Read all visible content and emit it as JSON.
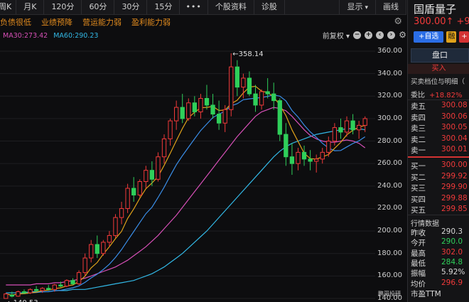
{
  "toolbar": {
    "tabs": [
      "周K",
      "月K",
      "120分",
      "60分",
      "30分",
      "15分",
      "•••",
      "个股资料",
      "诊股"
    ],
    "display_label": "显示",
    "draw_label": "画线"
  },
  "tags": [
    "负债很低",
    "业绩预降",
    "营运能力弱",
    "盈利能力弱"
  ],
  "ma": {
    "ma30": "MA30:273.42",
    "ma60": "MA60:290.23",
    "adjust_label": "前复权"
  },
  "colors": {
    "up": "#f23a3a",
    "down": "#2fcf5a",
    "ma5": "#e0a21a",
    "ma10": "#3a8ee8",
    "ma30": "#d64fb6",
    "ma60": "#32b8e6",
    "tag": "#e08a1e"
  },
  "chart_data": {
    "type": "candlestick",
    "y_ticks": [
      "360.00",
      "340.00",
      "320.00",
      "300.00",
      "280.00",
      "260.00",
      "240.00",
      "220.00",
      "200.00",
      "180.00",
      "160.00",
      "140.00"
    ],
    "ylim": [
      140,
      365
    ],
    "high_label": "358.14",
    "low_label": "140.53",
    "ohlc": [
      [
        140,
        145,
        140,
        144
      ],
      [
        143,
        146,
        141,
        142
      ],
      [
        142,
        147,
        141.5,
        146
      ],
      [
        146,
        148,
        144,
        145
      ],
      [
        145,
        149,
        144,
        148
      ],
      [
        148,
        151,
        146,
        147
      ],
      [
        147,
        150,
        145,
        149
      ],
      [
        149,
        152,
        147,
        148
      ],
      [
        148,
        153,
        146,
        152
      ],
      [
        152,
        155,
        150,
        151
      ],
      [
        151,
        157,
        150,
        156
      ],
      [
        156,
        158,
        152,
        153
      ],
      [
        153,
        165,
        152,
        163
      ],
      [
        163,
        180,
        160,
        176
      ],
      [
        176,
        192,
        172,
        188
      ],
      [
        188,
        196,
        176,
        180
      ],
      [
        180,
        192,
        178,
        190
      ],
      [
        190,
        200,
        186,
        196
      ],
      [
        196,
        215,
        194,
        212
      ],
      [
        212,
        226,
        206,
        220
      ],
      [
        220,
        242,
        216,
        238
      ],
      [
        238,
        248,
        226,
        232
      ],
      [
        232,
        246,
        230,
        244
      ],
      [
        244,
        258,
        238,
        254
      ],
      [
        254,
        262,
        240,
        246
      ],
      [
        246,
        270,
        244,
        266
      ],
      [
        266,
        286,
        260,
        282
      ],
      [
        282,
        300,
        276,
        298
      ],
      [
        298,
        316,
        290,
        310
      ],
      [
        310,
        322,
        296,
        300
      ],
      [
        300,
        318,
        298,
        314
      ],
      [
        314,
        320,
        302,
        306
      ],
      [
        306,
        322,
        300,
        318
      ],
      [
        318,
        330,
        308,
        312
      ],
      [
        312,
        322,
        300,
        304
      ],
      [
        304,
        316,
        290,
        296
      ],
      [
        296,
        312,
        288,
        308
      ],
      [
        308,
        358.14,
        302,
        346
      ],
      [
        346,
        352,
        320,
        328
      ],
      [
        328,
        340,
        318,
        336
      ],
      [
        336,
        342,
        320,
        322
      ],
      [
        322,
        330,
        306,
        312
      ],
      [
        312,
        326,
        308,
        324
      ],
      [
        324,
        336,
        318,
        322
      ],
      [
        322,
        332,
        308,
        316
      ],
      [
        316,
        318,
        280,
        286
      ],
      [
        286,
        296,
        258,
        266
      ],
      [
        266,
        278,
        250,
        260
      ],
      [
        260,
        274,
        254,
        270
      ],
      [
        270,
        276,
        258,
        264
      ],
      [
        264,
        272,
        254,
        262
      ],
      [
        262,
        268,
        252,
        264
      ],
      [
        264,
        274,
        260,
        270
      ],
      [
        270,
        284,
        266,
        280
      ],
      [
        280,
        296,
        276,
        292
      ],
      [
        292,
        300,
        282,
        288
      ],
      [
        288,
        302,
        284,
        298
      ],
      [
        298,
        304,
        286,
        290
      ],
      [
        290,
        298,
        282,
        294
      ],
      [
        294,
        302,
        288,
        300
      ]
    ],
    "ma30": [
      152,
      152,
      152,
      152,
      152,
      153,
      153,
      153,
      154,
      154,
      155,
      156,
      157,
      158,
      160,
      162,
      164,
      166,
      168,
      171,
      174,
      178,
      182,
      186,
      191,
      196,
      202,
      208,
      214,
      221,
      228,
      235,
      242,
      249,
      256,
      263,
      270,
      277,
      284,
      290,
      296,
      302,
      306,
      308,
      310,
      309,
      307,
      302,
      296,
      290,
      285,
      282,
      280,
      279,
      279,
      280,
      281,
      280,
      278,
      274
    ],
    "ma60": [
      145,
      145,
      145,
      145,
      146,
      146,
      146,
      146,
      147,
      147,
      147,
      148,
      148,
      148,
      149,
      150,
      151,
      152,
      153,
      154,
      155,
      156,
      158,
      160,
      162,
      165,
      168,
      172,
      176,
      180,
      185,
      190,
      195,
      200,
      206,
      212,
      218,
      224,
      230,
      236,
      242,
      248,
      254,
      260,
      266,
      271,
      275,
      278,
      280,
      282,
      284,
      286,
      287,
      288,
      289,
      290,
      291,
      291,
      291,
      290
    ]
  },
  "right_panel": {
    "name": "国盾量子",
    "price": "300.00↑ +9",
    "add_label": "+自选",
    "btn_rong": "融",
    "btn_short": "+",
    "pan_label": "盘口",
    "buy_label": "买入",
    "detail_label": "买卖档位与明细（",
    "weibi_label": "委比",
    "weibi_value": "+18.82%",
    "asks": [
      {
        "label": "卖五",
        "value": "300.08"
      },
      {
        "label": "卖四",
        "value": "300.06"
      },
      {
        "label": "卖三",
        "value": "300.05"
      },
      {
        "label": "卖二",
        "value": "300.04"
      },
      {
        "label": "卖一",
        "value": "300.01"
      }
    ],
    "bids": [
      {
        "label": "买一",
        "value": "300.00"
      },
      {
        "label": "买二",
        "value": "299.92"
      },
      {
        "label": "买三",
        "value": "299.90"
      },
      {
        "label": "买四",
        "value": "299.88"
      },
      {
        "label": "买五",
        "value": "299.85"
      }
    ],
    "market_title": "行情数据",
    "stats": [
      {
        "label": "昨收",
        "value": "290.3",
        "color": "white"
      },
      {
        "label": "今开",
        "value": "290.0",
        "color": "green"
      },
      {
        "label": "最高",
        "value": "302.0",
        "color": "red"
      },
      {
        "label": "最低",
        "value": "284.8",
        "color": "green"
      },
      {
        "label": "振幅",
        "value": "5.92%",
        "color": "white"
      },
      {
        "label": "均价",
        "value": "296.9",
        "color": "red"
      },
      {
        "label": "市盈TTM",
        "value": "",
        "color": "white"
      }
    ],
    "watermark": "鹏哥投研"
  }
}
